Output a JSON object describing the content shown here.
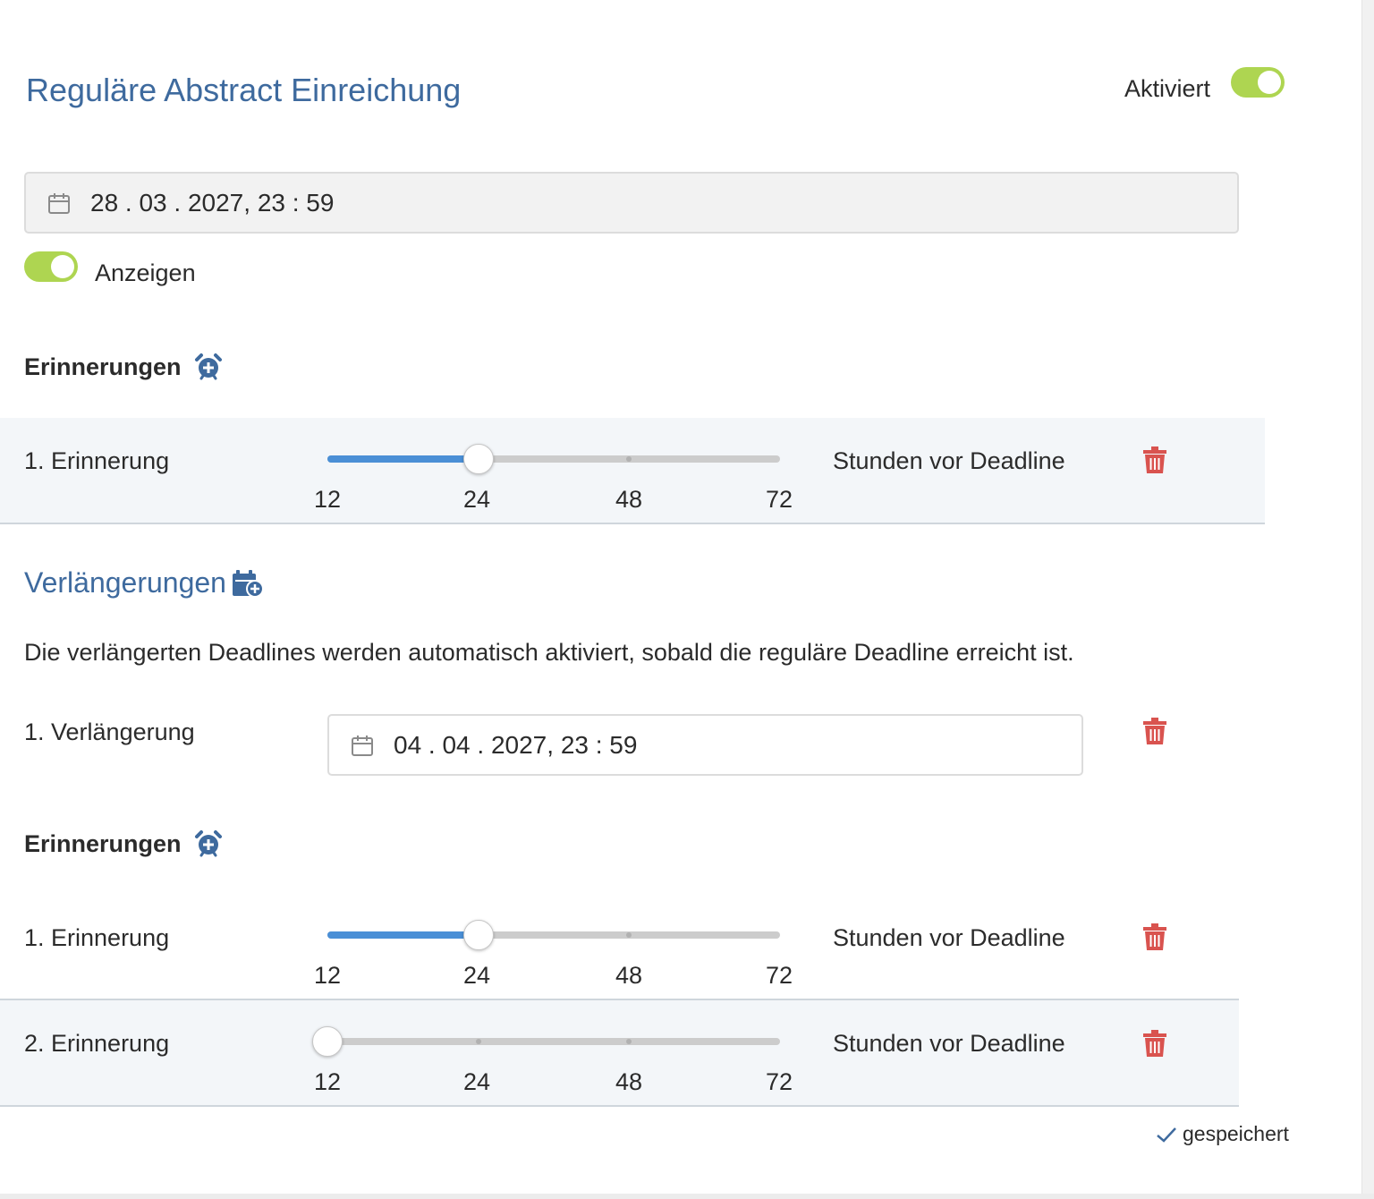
{
  "header": {
    "title": "Reguläre Abstract Einreichung",
    "activated_label": "Aktiviert",
    "activated": true
  },
  "deadline": {
    "value": "28 . 03 . 2027, 23 : 59",
    "icon": "calendar-icon"
  },
  "show_toggle": {
    "label": "Anzeigen",
    "on": true
  },
  "reminders_heading": "Erinnerungen",
  "slider_ticks": [
    "12",
    "24",
    "48",
    "72"
  ],
  "regular_reminders": [
    {
      "label": "1. Erinnerung",
      "value_hours": 24,
      "unit_label": "Stunden vor Deadline"
    }
  ],
  "extensions": {
    "heading": "Verlängerungen",
    "description": "Die verlängerten Deadlines werden automatisch aktiviert, sobald die reguläre Deadline erreicht ist.",
    "items": [
      {
        "label": "1. Verlängerung",
        "date": "04 . 04 . 2027, 23 : 59",
        "reminders_heading": "Erinnerungen",
        "reminders": [
          {
            "label": "1. Erinnerung",
            "value_hours": 24,
            "unit_label": "Stunden vor Deadline"
          },
          {
            "label": "2. Erinnerung",
            "value_hours": 12,
            "unit_label": "Stunden vor Deadline"
          }
        ]
      }
    ]
  },
  "status": {
    "saved_label": "gespeichert"
  },
  "colors": {
    "accent_blue": "#3e6a9e",
    "toggle_green": "#aed551",
    "slider_fill": "#4a8fd6",
    "delete_red": "#d9534f"
  }
}
